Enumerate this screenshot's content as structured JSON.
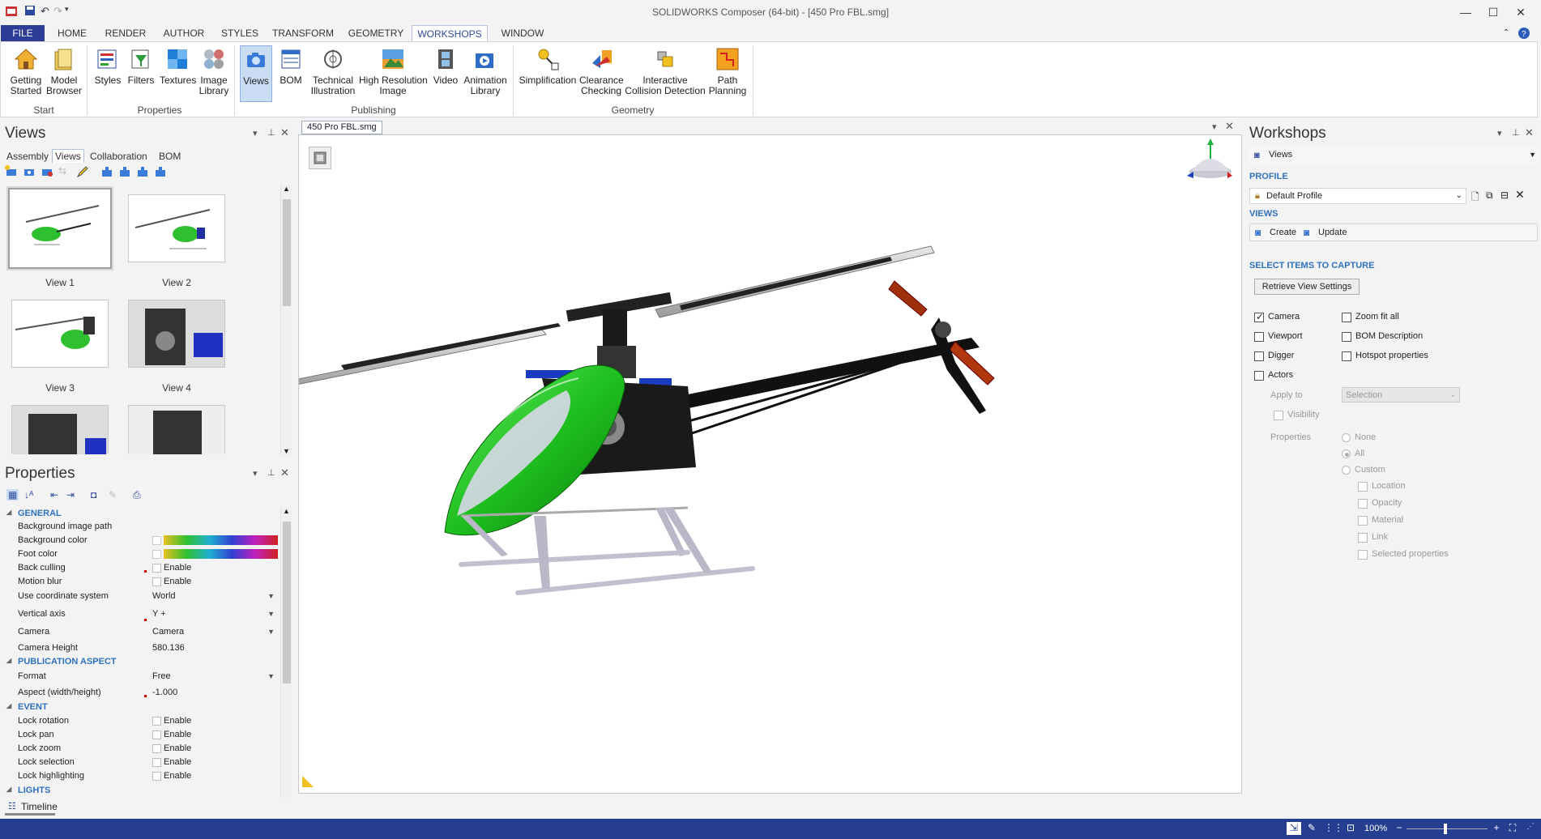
{
  "window": {
    "title": "SOLIDWORKS Composer (64-bit) - [450 Pro FBL.smg]"
  },
  "menu": [
    "FILE",
    "HOME",
    "RENDER",
    "AUTHOR",
    "STYLES",
    "TRANSFORM",
    "GEOMETRY",
    "WORKSHOPS",
    "WINDOW"
  ],
  "ribbon": {
    "buttons": [
      {
        "label": "Getting\nStarted"
      },
      {
        "label": "Model\nBrowser"
      },
      {
        "label": "Styles"
      },
      {
        "label": "Filters"
      },
      {
        "label": "Textures"
      },
      {
        "label": "Image\nLibrary"
      },
      {
        "label": "Views"
      },
      {
        "label": "BOM"
      },
      {
        "label": "Technical\nIllustration"
      },
      {
        "label": "High Resolution\nImage"
      },
      {
        "label": "Video"
      },
      {
        "label": "Animation\nLibrary"
      },
      {
        "label": "Simplification"
      },
      {
        "label": "Clearance\nChecking"
      },
      {
        "label": "Interactive\nCollision Detection"
      },
      {
        "label": "Path\nPlanning"
      }
    ],
    "groups": [
      "Start",
      "Properties",
      "Publishing",
      "Geometry"
    ]
  },
  "views_panel": {
    "title": "Views",
    "tabs": [
      "Assembly",
      "Views",
      "Collaboration",
      "BOM"
    ],
    "thumbs": [
      "View 1",
      "View 2",
      "View 3",
      "View 4"
    ]
  },
  "properties_panel": {
    "title": "Properties",
    "sections": {
      "general": "GENERAL",
      "publication": "PUBLICATION ASPECT",
      "event": "EVENT",
      "lights": "LIGHTS"
    },
    "rows": {
      "bg_image": "Background image path",
      "bg_color": "Background color",
      "foot_color": "Foot color",
      "back_culling": "Back culling",
      "motion_blur": "Motion blur",
      "coord_sys": "Use coordinate system",
      "coord_sys_val": "World",
      "vertical_axis": "Vertical axis",
      "vertical_axis_val": "Y +",
      "camera": "Camera",
      "camera_val": "Camera",
      "camera_height": "Camera Height",
      "camera_height_val": "580.136",
      "format": "Format",
      "format_val": "Free",
      "aspect": "Aspect (width/height)",
      "aspect_val": "-1.000",
      "lock_rotation": "Lock rotation",
      "lock_pan": "Lock pan",
      "lock_zoom": "Lock zoom",
      "lock_selection": "Lock selection",
      "lock_highlighting": "Lock highlighting",
      "enable": "Enable"
    },
    "timeline": "Timeline"
  },
  "document": {
    "tab": "450 Pro FBL.smg"
  },
  "workshops": {
    "title": "Workshops",
    "selector": "Views",
    "profile_head": "PROFILE",
    "profile": "Default Profile",
    "views_head": "VIEWS",
    "create": "Create",
    "update": "Update",
    "select_head": "SELECT ITEMS TO CAPTURE",
    "retrieve": "Retrieve View Settings",
    "camera": "Camera",
    "zoom_fit": "Zoom fit all",
    "viewport": "Viewport",
    "bom_desc": "BOM Description",
    "digger": "Digger",
    "hotspot": "Hotspot properties",
    "actors": "Actors",
    "apply_to": "Apply to",
    "apply_val": "Selection",
    "visibility": "Visibility",
    "properties": "Properties",
    "none": "None",
    "all": "All",
    "custom": "Custom",
    "location": "Location",
    "opacity": "Opacity",
    "material": "Material",
    "link": "Link",
    "selected_props": "Selected properties"
  },
  "status": {
    "zoom": "100%"
  }
}
